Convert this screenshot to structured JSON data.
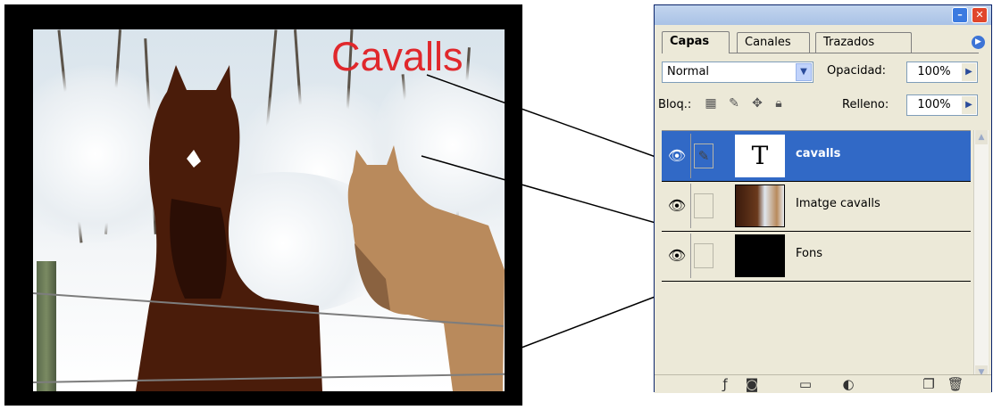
{
  "image": {
    "title_text": "Cavalls"
  },
  "palette": {
    "tabs": [
      "Capas",
      "Canales",
      "Trazados"
    ],
    "blend_mode": "Normal",
    "opacity_label": "Opacidad:",
    "opacity_value": "100%",
    "lock_label": "Bloq.:",
    "fill_label": "Relleno:",
    "fill_value": "100%",
    "layers": [
      {
        "name": "cavalls",
        "thumb": "T",
        "selected": true
      },
      {
        "name": "Imatge cavalls"
      },
      {
        "name": "Fons"
      }
    ]
  }
}
